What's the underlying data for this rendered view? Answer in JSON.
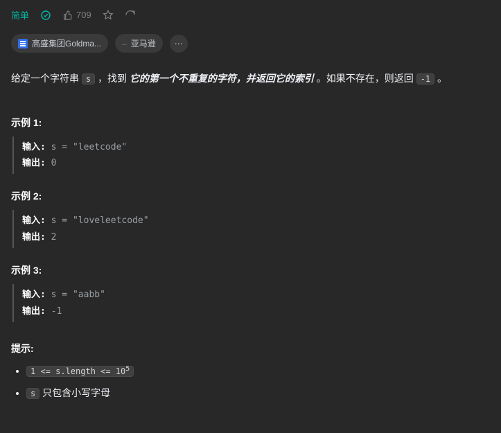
{
  "topbar": {
    "difficulty": "简单",
    "likes": "709"
  },
  "tags": {
    "company1": "高盛集团Goldma...",
    "company2": "亚马逊",
    "more": "⋯"
  },
  "desc": {
    "p1": "给定一个字符串 ",
    "code_s": "s",
    "p2": " ，找到 ",
    "em": "它的第一个不重复的字符，并返回它的索引",
    "p3": " 。如果不存在，则返回 ",
    "code_neg1": "-1",
    "p4": " 。"
  },
  "examples": [
    {
      "title": "示例 1:",
      "inLabel": "输入:",
      "inVal": " s = \"leetcode\"",
      "outLabel": "输出:",
      "outVal": " 0"
    },
    {
      "title": "示例 2:",
      "inLabel": "输入:",
      "inVal": " s = \"loveleetcode\"",
      "outLabel": "输出:",
      "outVal": " 2"
    },
    {
      "title": "示例 3:",
      "inLabel": "输入:",
      "inVal": " s = \"aabb\"",
      "outLabel": "输出:",
      "outVal": " -1"
    }
  ],
  "hints": {
    "title": "提示:",
    "c1a": "1 <= s.length <= 10",
    "c1sup": "5",
    "c2code": "s",
    "c2text": " 只包含小写字母"
  }
}
